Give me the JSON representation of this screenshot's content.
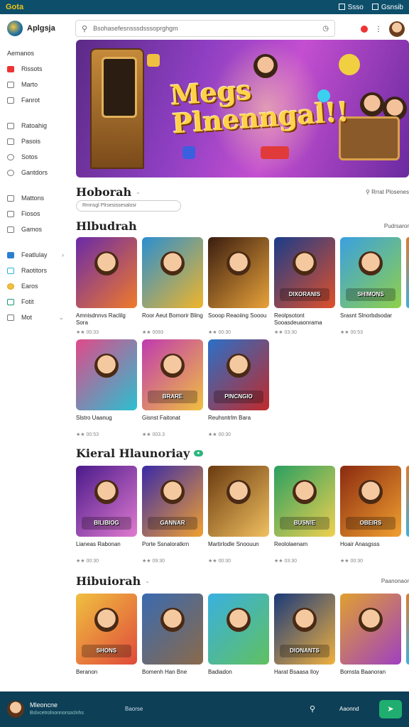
{
  "topbar": {
    "brand": "Gota",
    "items": [
      "Ssso",
      "Gsnsib"
    ]
  },
  "header": {
    "app_name": "Aplgsja",
    "search_placeholder": "Bsohasefesnsssdsssoprghgm"
  },
  "sidebar": {
    "heading": "Aemanos",
    "group1": [
      {
        "icon": "home-icon",
        "label": "Rissots"
      },
      {
        "icon": "document-icon",
        "label": "Marto"
      },
      {
        "icon": "grid-icon",
        "label": "Fanrot"
      }
    ],
    "group2": [
      {
        "icon": "chart-icon",
        "label": "Ratoahig"
      },
      {
        "icon": "list-icon",
        "label": "Pasois"
      },
      {
        "icon": "clock-icon",
        "label": "Sotos"
      },
      {
        "icon": "settings-icon",
        "label": "Gantdors"
      }
    ],
    "group3": [
      {
        "icon": "list-icon",
        "label": "Mattons"
      },
      {
        "icon": "calendar-icon",
        "label": "Fiosos"
      },
      {
        "icon": "users-icon",
        "label": "Gamos"
      }
    ],
    "group4": [
      {
        "icon": "folder-icon",
        "label": "Featlulay"
      },
      {
        "icon": "bell-icon",
        "label": "Raotitors"
      },
      {
        "icon": "star-icon",
        "label": "Earos"
      },
      {
        "icon": "chat-icon",
        "label": "Fotit"
      },
      {
        "icon": "more-icon",
        "label": "Mot"
      }
    ]
  },
  "hero": {
    "title_line1": "Megs",
    "title_line2": "Plnenngal!!"
  },
  "section1": {
    "title": "Hoborah",
    "link": "Rrrat Plosenes",
    "filter": "Rmnsgl  Plrsesissesalosr"
  },
  "section2": {
    "title": "Hlbudrah",
    "link": "Pudrsaror",
    "row1": [
      {
        "name": "Amnisdnnvs Raclilg Sora",
        "meta": "★★ 00:33",
        "tag": "",
        "colors": [
          "#6a2aa8",
          "#f07a2a"
        ]
      },
      {
        "name": "Roor Aeut Bomorir Bling",
        "meta": "★★ 0093",
        "tag": "",
        "colors": [
          "#2a8fd0",
          "#f0b52a"
        ]
      },
      {
        "name": "Sooop Reaoiing Sooou",
        "meta": "★★ 00:30",
        "tag": "",
        "colors": [
          "#3a1d10",
          "#e8a23a"
        ]
      },
      {
        "name": "Reolpsotont Sooasdeuaonrama",
        "meta": "★★ 03:30",
        "tag": "DIXORANIS",
        "colors": [
          "#1a3c8a",
          "#e0502a"
        ]
      },
      {
        "name": "Srasnt Slnorbdsodar",
        "meta": "★★ 00:53",
        "tag": "SHIMONS",
        "colors": [
          "#3aa0e0",
          "#8fd04a"
        ]
      }
    ],
    "row2": [
      {
        "name": "Slstro Uaanug",
        "meta": "★★ 00:53",
        "tag": "",
        "colors": [
          "#e04a8a",
          "#2ac0d0"
        ]
      },
      {
        "name": "Gisnst Faitonat",
        "meta": "★★ 003.3",
        "tag": "BRARE",
        "colors": [
          "#c03ab0",
          "#f0c040"
        ]
      },
      {
        "name": "Reuhsntrlm Bara",
        "meta": "★★ 00:30",
        "tag": "PINCNGIO",
        "colors": [
          "#2a70c8",
          "#c02a2a"
        ]
      }
    ]
  },
  "section3": {
    "title": "Kieral Hlaunoriay",
    "badge": "",
    "cards": [
      {
        "name": "Lianeas Rabonan",
        "meta": "★★ 00:30",
        "tag": "BILIBIOG",
        "colors": [
          "#4a1a8a",
          "#e07ad0"
        ]
      },
      {
        "name": "Porte Ssnaloratkrn",
        "meta": "★★ 09:30",
        "tag": "GANNAR",
        "colors": [
          "#3a2aa8",
          "#f0a030"
        ]
      },
      {
        "name": "Martirlodle Snoouun",
        "meta": "★★ 00:30",
        "tag": "",
        "colors": [
          "#6a3a10",
          "#f0c060"
        ]
      },
      {
        "name": "Reololaenam",
        "meta": "★★ 03:30",
        "tag": "BUSNIE",
        "colors": [
          "#2aa060",
          "#f0d050"
        ]
      },
      {
        "name": "Hoair Anasgsss",
        "meta": "★★ 00:30",
        "tag": "OBEIRS",
        "colors": [
          "#8a2a10",
          "#f0a030"
        ]
      }
    ]
  },
  "section4": {
    "title": "Hibuiorah",
    "link": "Paanonaor",
    "cards": [
      {
        "name": "Beranon",
        "tag": "SHONS",
        "colors": [
          "#f0c040",
          "#e04a3a"
        ]
      },
      {
        "name": "Bomenh Han Bne",
        "tag": "",
        "colors": [
          "#3a6ab0",
          "#8a6a4a"
        ]
      },
      {
        "name": "Badiadon",
        "tag": "",
        "colors": [
          "#3ab0e0",
          "#60c060"
        ]
      },
      {
        "name": "Harat Bsaasa Iloy",
        "tag": "DIONANTS",
        "colors": [
          "#1a3a7a",
          "#f0b040"
        ]
      },
      {
        "name": "Bomsta Baanoran",
        "tag": "",
        "colors": [
          "#e0a030",
          "#a040c0"
        ]
      }
    ]
  },
  "bottom": {
    "title": "Mleoncne",
    "subtitle": "Bslvcetrolnonnorsoclnhs",
    "middle": "Baorse",
    "right": "Aaonnd"
  }
}
